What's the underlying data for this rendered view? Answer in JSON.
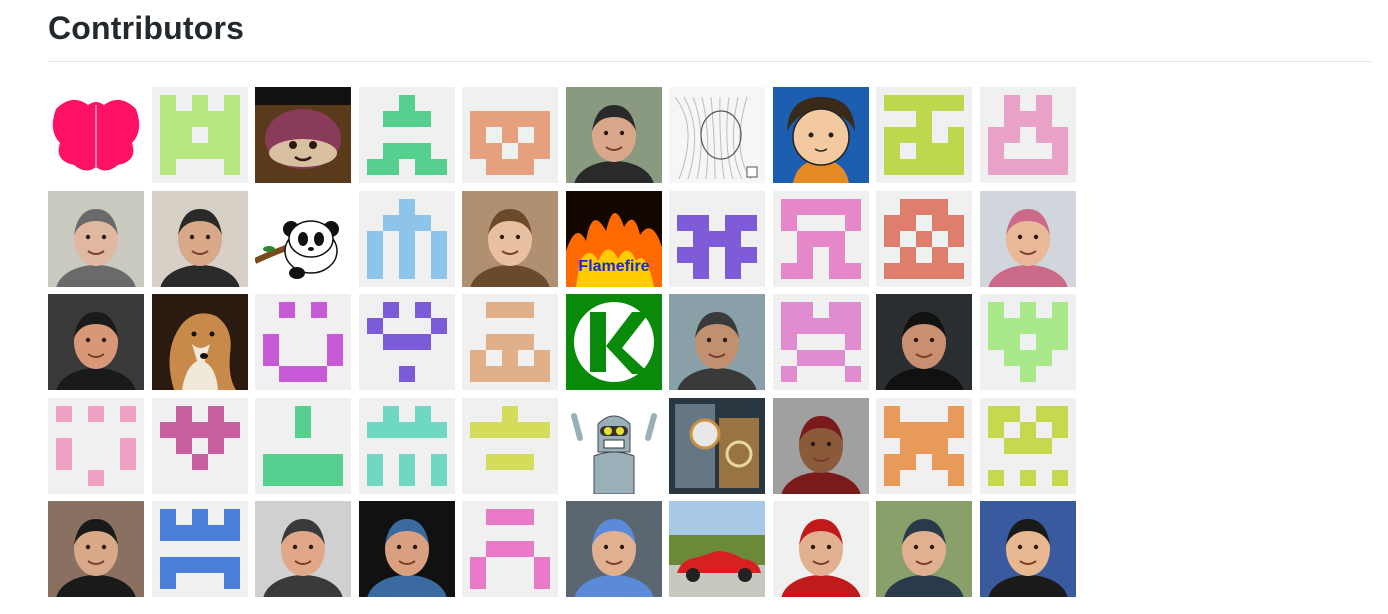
{
  "page": {
    "title": "Contributors"
  },
  "palette": {
    "identicon_bg": "#f0f0f0",
    "rule": "#e5e5e5",
    "title_text": "#24292e"
  },
  "contributors": [
    {
      "kind": "photo",
      "subject": "pink-blob",
      "bg": "#ffffff",
      "fg": "#ff1166",
      "accent": "#ffffff"
    },
    {
      "kind": "identicon",
      "color": "#b5e67f",
      "pattern": [
        "10101",
        "11111",
        "11011",
        "11111",
        "10001"
      ]
    },
    {
      "kind": "photo",
      "subject": "turnip-face",
      "bg": "#5a3a1a",
      "fg": "#8a3a5a",
      "accent": "#d8c0a0"
    },
    {
      "kind": "identicon",
      "color": "#55d08e",
      "pattern": [
        "00100",
        "01110",
        "00000",
        "01110",
        "11011"
      ]
    },
    {
      "kind": "identicon",
      "color": "#e5a07e",
      "pattern": [
        "00000",
        "11111",
        "10101",
        "11011",
        "01110"
      ]
    },
    {
      "kind": "photo",
      "subject": "man-smiling",
      "bg": "#8a9a80",
      "fg": "#d9a88a",
      "accent": "#2a2a2a"
    },
    {
      "kind": "photo",
      "subject": "pencil-sketch",
      "bg": "#f6f6f6",
      "fg": "#bbbbbb",
      "accent": "#555555"
    },
    {
      "kind": "photo",
      "subject": "cartoon-girl",
      "bg": "#1c5fb0",
      "fg": "#f3c9a0",
      "accent": "#e58a22"
    },
    {
      "kind": "identicon",
      "color": "#bcd84e",
      "pattern": [
        "11111",
        "00100",
        "11101",
        "10111",
        "11111"
      ]
    },
    {
      "kind": "identicon",
      "color": "#e9a3c9",
      "pattern": [
        "01010",
        "01110",
        "11011",
        "10001",
        "11111"
      ]
    },
    {
      "kind": "photo",
      "subject": "older-man-glasses",
      "bg": "#c9c9c0",
      "fg": "#e0b8a0",
      "accent": "#6a6a6a"
    },
    {
      "kind": "photo",
      "subject": "man-short-hair",
      "bg": "#d6d0c6",
      "fg": "#d8a888",
      "accent": "#2a2a2a"
    },
    {
      "kind": "photo",
      "subject": "panda",
      "bg": "#ffffff",
      "fg": "#111111",
      "accent": "#7a4a1a"
    },
    {
      "kind": "identicon",
      "color": "#8ec3ea",
      "pattern": [
        "00100",
        "01110",
        "10101",
        "10101",
        "10101"
      ]
    },
    {
      "kind": "photo",
      "subject": "woman-long-hair",
      "bg": "#b09070",
      "fg": "#e8c0a0",
      "accent": "#6a4a2a"
    },
    {
      "kind": "photo",
      "subject": "flamefire",
      "bg": "#120800",
      "fg": "#ff6a00",
      "accent": "#1a2ccc",
      "label": "Flamefire"
    },
    {
      "kind": "identicon",
      "color": "#7f5bd8",
      "pattern": [
        "00000",
        "11011",
        "01110",
        "11011",
        "01010"
      ]
    },
    {
      "kind": "identicon",
      "color": "#e587c9",
      "pattern": [
        "11111",
        "10001",
        "01110",
        "01010",
        "11011"
      ]
    },
    {
      "kind": "identicon",
      "color": "#de7f6e",
      "pattern": [
        "01110",
        "11011",
        "10101",
        "01010",
        "11111"
      ]
    },
    {
      "kind": "photo",
      "subject": "man-pink-shirt",
      "bg": "#d0d6dc",
      "fg": "#e8b898",
      "accent": "#cc6a8a"
    },
    {
      "kind": "photo",
      "subject": "man-curly-glasses",
      "bg": "#3a3a3a",
      "fg": "#d89878",
      "accent": "#1a1a1a"
    },
    {
      "kind": "photo",
      "subject": "collie-dog",
      "bg": "#2a1a10",
      "fg": "#c88a4a",
      "accent": "#f0e8d8"
    },
    {
      "kind": "identicon",
      "color": "#c85ad8",
      "pattern": [
        "01010",
        "00000",
        "10001",
        "10001",
        "01110"
      ]
    },
    {
      "kind": "identicon",
      "color": "#7a5bd8",
      "pattern": [
        "01010",
        "10001",
        "01110",
        "00000",
        "00100"
      ]
    },
    {
      "kind": "identicon",
      "color": "#e0b08a",
      "pattern": [
        "01110",
        "00000",
        "01110",
        "10101",
        "11111"
      ]
    },
    {
      "kind": "photo",
      "subject": "k-logo",
      "bg": "#0a8a0a",
      "fg": "#ffffff",
      "accent": "#ffffff"
    },
    {
      "kind": "photo",
      "subject": "cyclist-helmet",
      "bg": "#8aa0a8",
      "fg": "#c09070",
      "accent": "#3a3a3a"
    },
    {
      "kind": "identicon",
      "color": "#e08ad0",
      "pattern": [
        "11011",
        "11111",
        "10001",
        "01110",
        "10001"
      ]
    },
    {
      "kind": "photo",
      "subject": "man-beard-selfie",
      "bg": "#2a2e30",
      "fg": "#c89070",
      "accent": "#111111"
    },
    {
      "kind": "identicon",
      "color": "#a8e88a",
      "pattern": [
        "10101",
        "11111",
        "11011",
        "01110",
        "00100"
      ]
    },
    {
      "kind": "identicon",
      "color": "#f0a0c0",
      "pattern": [
        "10101",
        "00000",
        "10001",
        "10001",
        "00100"
      ]
    },
    {
      "kind": "identicon",
      "color": "#c860a0",
      "pattern": [
        "01010",
        "11111",
        "01010",
        "00100",
        "00000"
      ]
    },
    {
      "kind": "identicon",
      "color": "#55d08e",
      "pattern": [
        "00100",
        "00100",
        "00000",
        "11111",
        "11111"
      ]
    },
    {
      "kind": "identicon",
      "color": "#6ed8c0",
      "pattern": [
        "01010",
        "11111",
        "00000",
        "10101",
        "10101"
      ]
    },
    {
      "kind": "identicon",
      "color": "#d4dc5a",
      "pattern": [
        "00100",
        "11111",
        "00000",
        "01110",
        "00000"
      ]
    },
    {
      "kind": "photo",
      "subject": "robot-bender",
      "bg": "#ffffff",
      "fg": "#9ab0b8",
      "accent": "#e8e030"
    },
    {
      "kind": "photo",
      "subject": "steampunk-art",
      "bg": "#2a3640",
      "fg": "#a0b8c8",
      "accent": "#c89040"
    },
    {
      "kind": "photo",
      "subject": "woman-red-hair",
      "bg": "#a0a0a0",
      "fg": "#8a5a3a",
      "accent": "#7a1a1a"
    },
    {
      "kind": "identicon",
      "color": "#e89a5a",
      "pattern": [
        "10001",
        "11111",
        "01110",
        "11011",
        "10001"
      ]
    },
    {
      "kind": "identicon",
      "color": "#c8d84e",
      "pattern": [
        "11011",
        "10101",
        "01110",
        "00000",
        "10101"
      ]
    },
    {
      "kind": "photo",
      "subject": "man-cat-shirt",
      "bg": "#8a7060",
      "fg": "#d8a888",
      "accent": "#1a1a1a"
    },
    {
      "kind": "identicon",
      "color": "#4a7ed8",
      "pattern": [
        "10101",
        "11111",
        "00000",
        "11111",
        "10001"
      ]
    },
    {
      "kind": "photo",
      "subject": "man-smiling-2",
      "bg": "#d0d0d0",
      "fg": "#e0a888",
      "accent": "#3a3a3a"
    },
    {
      "kind": "photo",
      "subject": "man-grin-dark",
      "bg": "#111111",
      "fg": "#d8a080",
      "accent": "#3a6aa0"
    },
    {
      "kind": "identicon",
      "color": "#e87ac8",
      "pattern": [
        "01110",
        "00000",
        "01110",
        "10001",
        "10001"
      ]
    },
    {
      "kind": "photo",
      "subject": "man-from-above",
      "bg": "#5a6670",
      "fg": "#e0b090",
      "accent": "#5a8ad8"
    },
    {
      "kind": "photo",
      "subject": "red-car",
      "bg": "#a8c8e8",
      "fg": "#d82020",
      "accent": "#6a8a3a"
    },
    {
      "kind": "photo",
      "subject": "bearded-man-vest",
      "bg": "#f0f0f0",
      "fg": "#e0b090",
      "accent": "#c01a1a"
    },
    {
      "kind": "photo",
      "subject": "man-glasses-outdoor",
      "bg": "#8aa06a",
      "fg": "#e0b090",
      "accent": "#2a3a4a"
    },
    {
      "kind": "photo",
      "subject": "man-bald-smile",
      "bg": "#3a5aa0",
      "fg": "#e8b890",
      "accent": "#1a1a1a"
    }
  ]
}
